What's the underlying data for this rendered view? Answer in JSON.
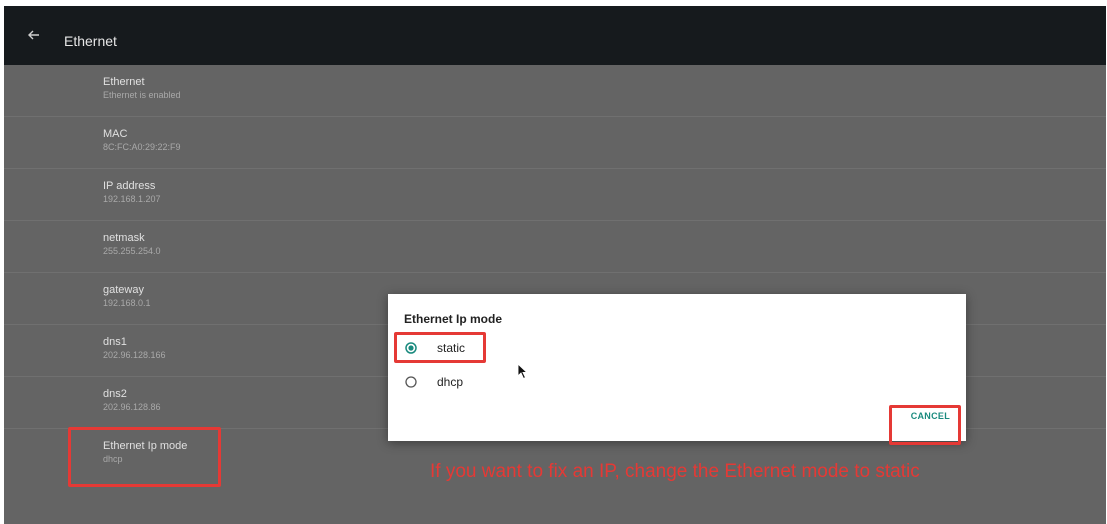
{
  "header": {
    "title": "Ethernet",
    "back_icon": "arrow-left-icon"
  },
  "settings": [
    {
      "title": "Ethernet",
      "value": "Ethernet is enabled"
    },
    {
      "title": "MAC",
      "value": "8C:FC:A0:29:22:F9"
    },
    {
      "title": "IP address",
      "value": "192.168.1.207"
    },
    {
      "title": "netmask",
      "value": "255.255.254.0"
    },
    {
      "title": "gateway",
      "value": "192.168.0.1"
    },
    {
      "title": "dns1",
      "value": "202.96.128.166"
    },
    {
      "title": "dns2",
      "value": "202.96.128.86"
    },
    {
      "title": "Ethernet Ip mode",
      "value": "dhcp"
    }
  ],
  "dialog": {
    "title": "Ethernet Ip mode",
    "options": [
      {
        "label": "static",
        "selected": true
      },
      {
        "label": "dhcp",
        "selected": false
      }
    ],
    "cancel_label": "CANCEL"
  },
  "annotation": {
    "text": "If you want to fix an IP, change the Ethernet mode to static"
  },
  "colors": {
    "accent": "#1a8a7e",
    "highlight": "#e53935",
    "appbar": "#161a1d",
    "background": "#646464"
  }
}
